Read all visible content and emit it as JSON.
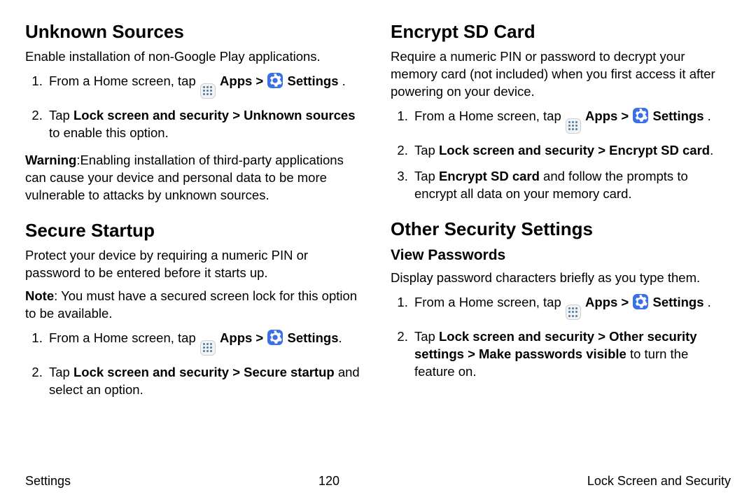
{
  "col1": {
    "h1": "Unknown Sources",
    "p1": "Enable installation of non-Google Play applications.",
    "step1_a": "From a Home screen, tap ",
    "apps": "Apps",
    "gt": " > ",
    "settings": "Settings",
    "period": " .",
    "periodTight": ".",
    "step2_a": "Tap ",
    "step2_b": "Lock screen and security > Unknown sources",
    "step2_c": " to enable this option.",
    "warn_label": "Warning",
    "warn_text": ":Enabling installation of third-party applications can cause your device and personal data to be more vulnerable to attacks by unknown sources.",
    "h2": "Secure Startup",
    "p2": "Protect your device by requiring a numeric PIN or password to be entered before it starts up.",
    "note_label": "Note",
    "note_text": ": You must have a secured screen lock for this option to be available.",
    "ss_step2_a": "Tap ",
    "ss_step2_b": "Lock screen and security > Secure startup",
    "ss_step2_c": " and select an option."
  },
  "col2": {
    "h1": "Encrypt SD Card",
    "p1": "Require a numeric PIN or password to decrypt your memory card (not included) when you first access it after powering on your device.",
    "step2_a": "Tap ",
    "step2_b": "Lock screen and security > Encrypt SD card",
    "step2_c": ".",
    "step3_a": "Tap ",
    "step3_b": "Encrypt SD card",
    "step3_c": " and follow the prompts to encrypt all data on your memory card.",
    "h2": "Other Security Settings",
    "h3": "View Passwords",
    "p2": "Display password characters briefly as you type them.",
    "vp_step2_a": "Tap ",
    "vp_step2_b": "Lock screen and security > Other security settings > Make passwords visible",
    "vp_step2_c": " to turn the feature on."
  },
  "footer": {
    "left": "Settings",
    "center": "120",
    "right": "Lock Screen and Security"
  }
}
